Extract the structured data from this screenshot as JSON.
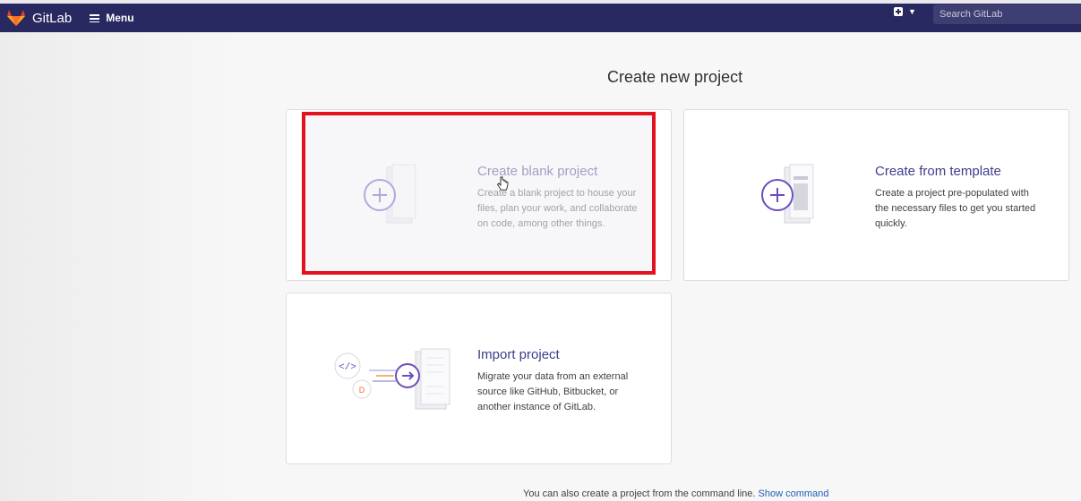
{
  "header": {
    "brand": "GitLab",
    "menu_label": "Menu",
    "new_icon": "plus-square-icon",
    "search_placeholder": "Search GitLab"
  },
  "main": {
    "title": "Create new project",
    "cards": [
      {
        "title": "Create blank project",
        "description": "Create a blank project to house your files, plan your work, and collaborate on code, among other things.",
        "icon": "blank-project-plus-icon"
      },
      {
        "title": "Create from template",
        "description": "Create a project pre-populated with the necessary files to get you started quickly.",
        "icon": "template-plus-icon"
      },
      {
        "title": "Import project",
        "description": "Migrate your data from an external source like GitHub, Bitbucket, or another instance of GitLab.",
        "icon": "import-arrow-icon"
      }
    ],
    "footer_text": "You can also create a project from the command line.",
    "footer_link": "Show command"
  },
  "colors": {
    "navbar": "#292961",
    "accent_purple": "#6b4fbb",
    "title_purple": "#3f3c8c",
    "highlight_red": "#e3121f",
    "link_blue": "#1f5fb8"
  }
}
